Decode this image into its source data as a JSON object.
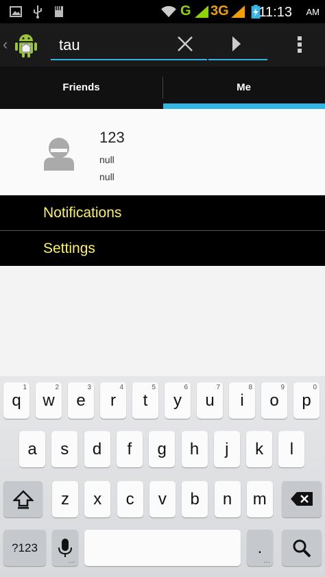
{
  "status_bar": {
    "network_g": "G",
    "network_3g": "3G",
    "time": "11:13",
    "ampm": "AM",
    "accent_green": "#8fd400",
    "accent_orange": "#f0a000"
  },
  "action_bar": {
    "search_value": "tau",
    "search_placeholder": ""
  },
  "tabs": [
    "Friends",
    "Me"
  ],
  "profile": {
    "name": "123",
    "line1": "null",
    "line2": "null"
  },
  "menu": {
    "notifications": "Notifications",
    "settings": "Settings",
    "text_color": "#fdf25a"
  },
  "keyboard": {
    "row1": [
      {
        "ch": "q",
        "hint": "1"
      },
      {
        "ch": "w",
        "hint": "2"
      },
      {
        "ch": "e",
        "hint": "3"
      },
      {
        "ch": "r",
        "hint": "4"
      },
      {
        "ch": "t",
        "hint": "5"
      },
      {
        "ch": "y",
        "hint": "6"
      },
      {
        "ch": "u",
        "hint": "7"
      },
      {
        "ch": "i",
        "hint": "8"
      },
      {
        "ch": "o",
        "hint": "9"
      },
      {
        "ch": "p",
        "hint": "0"
      }
    ],
    "row2": [
      "a",
      "s",
      "d",
      "f",
      "g",
      "h",
      "j",
      "k",
      "l"
    ],
    "row3": [
      "z",
      "x",
      "c",
      "v",
      "b",
      "n",
      "m"
    ],
    "symbols_label": "?123",
    "period": ".",
    "period_hint": "…"
  }
}
